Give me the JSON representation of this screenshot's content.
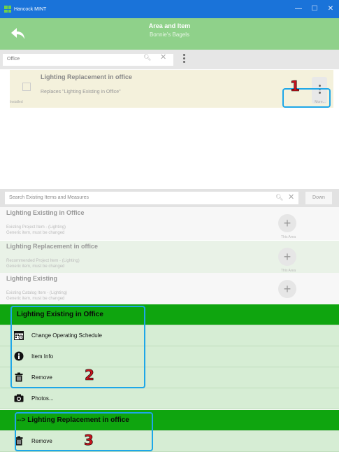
{
  "window": {
    "title": "Hancock MINT",
    "controls": [
      "—",
      "☐",
      "✕"
    ]
  },
  "header": {
    "title": "Area and Item",
    "subtitle": "Bonnie's Bagels"
  },
  "area_filter": {
    "value": "Office"
  },
  "selected_item": {
    "name": "Lighting Replacement in office",
    "description": "Replaces \"Lighting Existing in Office\"",
    "status": "Installed",
    "more_label": "More..."
  },
  "annotations": [
    "1",
    "2",
    "3"
  ],
  "search": {
    "placeholder": "Search Existing Items and Measures",
    "down_label": "Down"
  },
  "catalog": [
    {
      "name": "Lighting Existing in Office",
      "line1": "Existing Project Item - (Lighting)",
      "line2": "Generic item, must be changed",
      "tag": "This Area"
    },
    {
      "name": "Lighting Replacement in office",
      "line1": "Recommended Project Item - (Lighting)",
      "line2": "Generic item, must be changed",
      "tag": "This Area"
    },
    {
      "name": "Lighting Existing",
      "line1": "Existing Catalog Item - (Lighting)",
      "line2": "Generic item, must be changed",
      "tag": ""
    }
  ],
  "menu": {
    "group1_header": "Lighting Existing in Office",
    "change_schedule": "Change Operating Schedule",
    "item_info": "Item Info",
    "remove1": "Remove",
    "photos": "Photos...",
    "group2_header": "--> Lighting Replacement in office",
    "remove2": "Remove"
  },
  "colors": {
    "titlebar": "#1a73d9",
    "header": "#8fd18a",
    "menu_header": "#0fa50f",
    "menu_row": "#d6edd4",
    "annotation_box": "#1ea7e8",
    "annotation_number": "#c8141e"
  }
}
